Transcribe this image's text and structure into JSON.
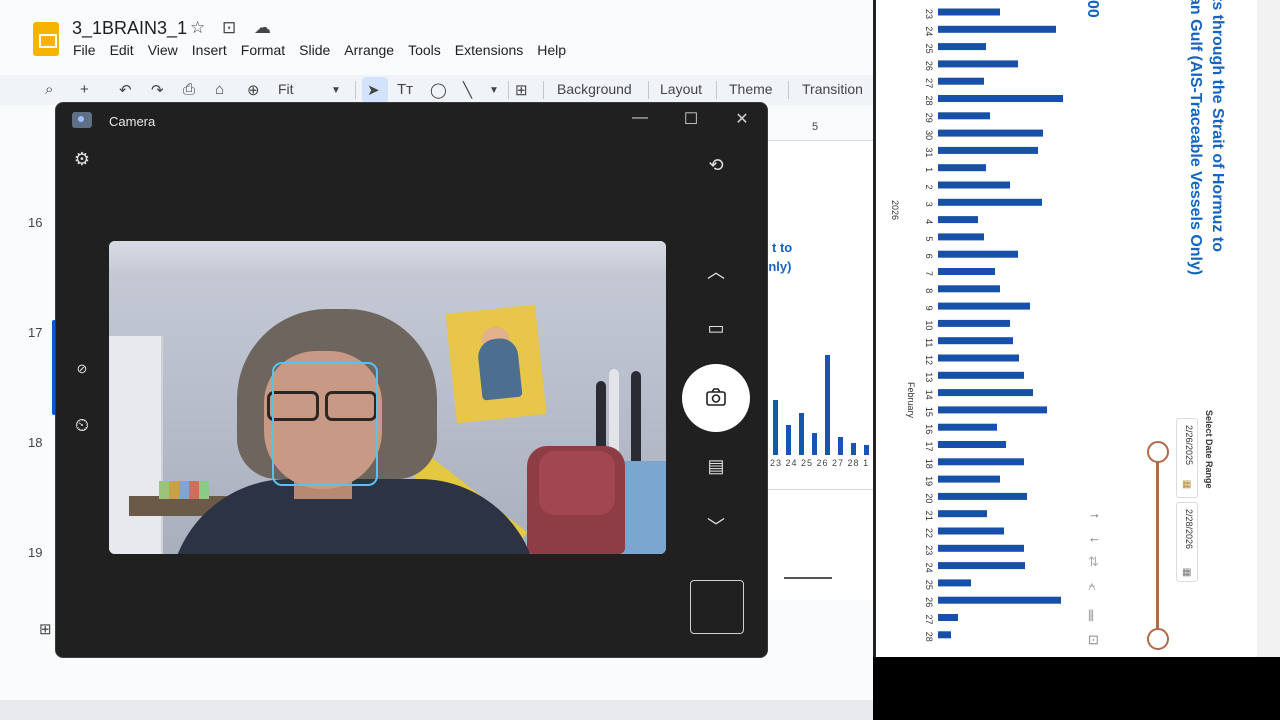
{
  "slides": {
    "doc_title": "3_1BRAIN3_1",
    "menu": [
      "File",
      "Edit",
      "View",
      "Insert",
      "Format",
      "Slide",
      "Arrange",
      "Tools",
      "Extensions",
      "Help"
    ],
    "toolbar": {
      "zoom": "Fit",
      "background": "Background",
      "layout": "Layout",
      "theme": "Theme",
      "transition": "Transition"
    },
    "ruler_top": "5",
    "slide_numbers": [
      "16",
      "17",
      "18",
      "19"
    ],
    "mini_title_1": "t to",
    "mini_title_2": ")nly)",
    "mini_axis": "23 24 25 26 27 28 1 2",
    "mini_bars": [
      0.55,
      0.3,
      0.42,
      0.22,
      1.0,
      0.18,
      0.12,
      0.1
    ]
  },
  "camera": {
    "title": "Camera",
    "icons": {
      "settings": "gear-icon",
      "switch_camera": "camera-switch-icon",
      "hdr": "hdr-off-icon",
      "timer": "timer-off-icon",
      "up": "chevron-up-icon",
      "video": "video-icon",
      "photo": "camera-icon",
      "document": "document-icon",
      "down": "chevron-down-icon"
    }
  },
  "chart": {
    "title_line_1": "ts through the Strait of Hormuz to",
    "title_line_2": "an Gulf (AIS-Traceable Vessels Only)",
    "title_clip": "00",
    "year_label": "2026",
    "month_label": "February",
    "date_range_label": "Select Date Range",
    "date_start": "2/26/2025",
    "date_end": "2/28/2026"
  },
  "chart_data": {
    "type": "bar",
    "orientation": "rotated",
    "categories": [
      "23",
      "24",
      "25",
      "26",
      "27",
      "28",
      "29",
      "30",
      "31",
      "1",
      "2",
      "3",
      "4",
      "5",
      "6",
      "7",
      "8",
      "9",
      "10",
      "11",
      "12",
      "13",
      "14",
      "15",
      "16",
      "17",
      "18",
      "19",
      "20",
      "21",
      "22",
      "23",
      "24",
      "25",
      "26",
      "27",
      "28"
    ],
    "values": [
      62,
      118,
      48,
      80,
      46,
      125,
      52,
      105,
      100,
      48,
      72,
      104,
      40,
      46,
      80,
      57,
      62,
      92,
      72,
      75,
      81,
      86,
      95,
      109,
      59,
      68,
      86,
      62,
      89,
      49,
      66,
      86,
      87,
      33,
      123,
      20,
      13
    ],
    "labels": {
      "year": "2026",
      "month": "February"
    }
  }
}
